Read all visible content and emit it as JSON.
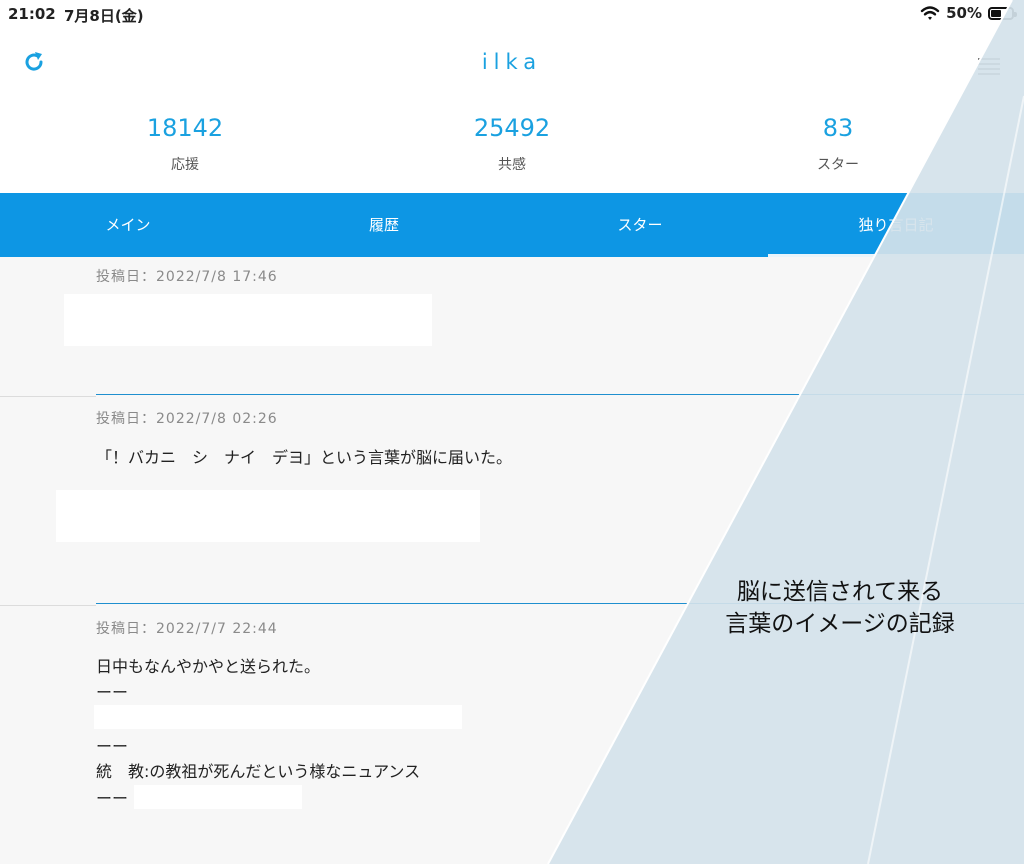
{
  "status": {
    "time": "21:02",
    "date": "7月8日(金)",
    "battery": "50%",
    "battery_level": 0.5
  },
  "header": {
    "title": "ilka"
  },
  "stats": [
    {
      "value": "18142",
      "label": "応援"
    },
    {
      "value": "25492",
      "label": "共感"
    },
    {
      "value": "83",
      "label": "スター"
    }
  ],
  "tabs": [
    {
      "label": "メイン"
    },
    {
      "label": "履歴"
    },
    {
      "label": "スター"
    },
    {
      "label": "独り言日記"
    }
  ],
  "posts": [
    {
      "date": "投稿日：2022/7/8 17:46",
      "lines": []
    },
    {
      "date": "投稿日：2022/7/8 02:26",
      "lines": [
        "「！バカニ　シ　ナイ　デヨ」という言葉が脳に届いた。"
      ]
    },
    {
      "date": "投稿日：2022/7/7 22:44",
      "lines": [
        "日中もなんやかやと送られた。",
        "ーー",
        "ーー",
        "統　教:の教祖が死んだという様なニュアンス",
        "ーー"
      ]
    }
  ],
  "overlay": {
    "line1": "脳に送信されて来る",
    "line2": "言葉のイメージの記録"
  },
  "colors": {
    "accent": "#1aa1e0",
    "tabbar": "#0d96e4",
    "stripe": "#d4e2ea",
    "separator": "#1f8fcf"
  },
  "icons": {
    "refresh": "refresh-icon",
    "menu": "hamburger-menu-icon",
    "wifi": "wifi-icon",
    "battery": "battery-icon"
  }
}
